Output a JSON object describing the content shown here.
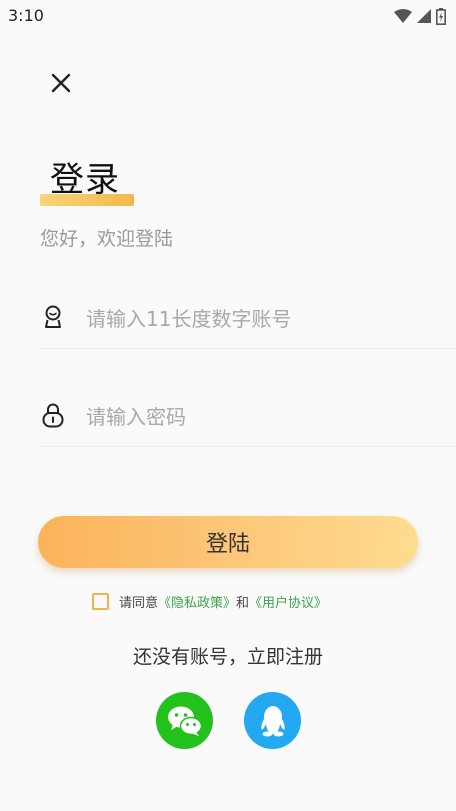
{
  "status_bar": {
    "time": "3:10",
    "icons": [
      "wifi-icon",
      "signal-icon",
      "battery-icon"
    ]
  },
  "header": {
    "close_icon": "close-icon"
  },
  "title": {
    "text": "登录",
    "subtitle": "您好，欢迎登陆",
    "underline_color": "#f3b84a"
  },
  "form": {
    "account": {
      "icon": "user-icon",
      "value": "",
      "placeholder": "请输入11长度数字账号"
    },
    "password": {
      "icon": "lock-icon",
      "value": "",
      "placeholder": "请输入密码"
    }
  },
  "login_button": {
    "label": "登陆",
    "gradient": [
      "#fbb35a",
      "#fedc90"
    ]
  },
  "agreement": {
    "checked": false,
    "prefix": "请同意",
    "privacy_link": "《隐私政策》",
    "and": "和",
    "user_link": "《用户协议》",
    "link_color": "#3aa54a",
    "checkbox_color": "#f5b24c"
  },
  "register": {
    "label": "还没有账号，立即注册"
  },
  "social": {
    "wechat": {
      "icon": "wechat-icon",
      "color": "#22c11c"
    },
    "qq": {
      "icon": "qq-icon",
      "color": "#23a9f2"
    }
  }
}
